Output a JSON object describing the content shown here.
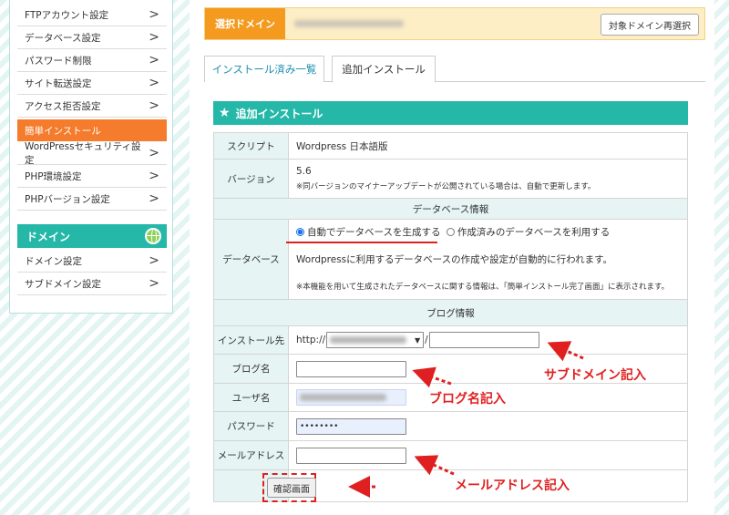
{
  "sidebar": {
    "items": [
      {
        "label": "FTPアカウント設定"
      },
      {
        "label": "データベース設定"
      },
      {
        "label": "パスワード制限"
      },
      {
        "label": "サイト転送設定"
      },
      {
        "label": "アクセス拒否設定"
      },
      {
        "label": "簡単インストール",
        "active": true
      },
      {
        "label": "WordPressセキュリティ設定"
      },
      {
        "label": "PHP環境設定"
      },
      {
        "label": "PHPバージョン設定"
      }
    ],
    "domain_header": "ドメイン",
    "domain_items": [
      {
        "label": "ドメイン設定"
      },
      {
        "label": "サブドメイン設定"
      }
    ],
    "chevron": ">"
  },
  "domain_bar": {
    "label": "選択ドメイン",
    "reselect_label": "対象ドメイン再選択"
  },
  "tabs": [
    {
      "label": "インストール済み一覧"
    },
    {
      "label": "追加インストール",
      "active": true
    }
  ],
  "section_title": "追加インストール",
  "form": {
    "script_label": "スクリプト",
    "script_value": "Wordpress 日本語版",
    "version_label": "バージョン",
    "version_value": "5.6",
    "version_note": "※同バージョンのマイナーアップデートが公開されている場合は、自動で更新します。",
    "db_info_heading": "データベース情報",
    "db_label": "データベース",
    "db_option_auto": "自動でデータベースを生成する",
    "db_option_existing": "作成済みのデータベースを利用する",
    "db_desc": "Wordpressに利用するデータベースの作成や設定が自動的に行われます。",
    "db_note": "※本機能を用いて生成されたデータベースに関する情報は、「簡単インストール完了画面」に表示されます。",
    "blog_info_heading": "ブログ情報",
    "install_label": "インストール先",
    "install_prefix": "http://",
    "install_sep": "/",
    "blogname_label": "ブログ名",
    "user_label": "ユーザ名",
    "password_label": "パスワード",
    "password_value": "••••••••",
    "email_label": "メールアドレス",
    "confirm_label": "確認画面"
  },
  "annotations": {
    "subdomain": "サブドメイン記入",
    "blogname": "ブログ名記入",
    "email": "メールアドレス記入",
    "color": "#e02020"
  }
}
